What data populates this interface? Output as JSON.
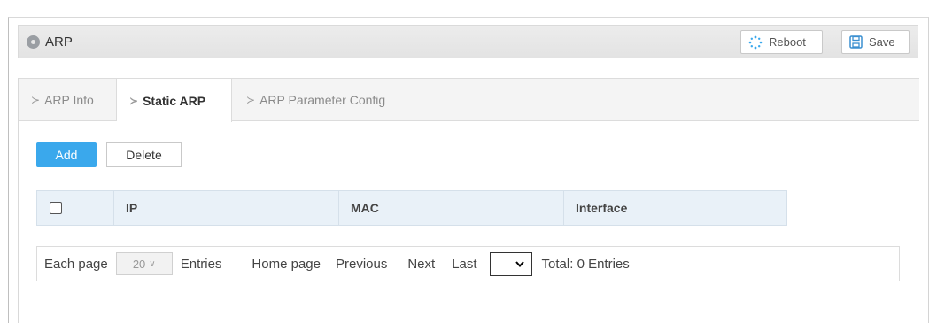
{
  "header": {
    "title": "ARP",
    "reboot_label": "Reboot",
    "save_label": "Save",
    "reboot_icon": "spinner-icon",
    "save_icon": "floppy-disk-icon",
    "title_icon": "circle-icon"
  },
  "tabs": [
    {
      "label": "ARP Info",
      "active": false
    },
    {
      "label": "Static ARP",
      "active": true
    },
    {
      "label": "ARP Parameter Config",
      "active": false
    }
  ],
  "actions": {
    "add_label": "Add",
    "delete_label": "Delete"
  },
  "table": {
    "columns": [
      "IP",
      "MAC",
      "Interface"
    ],
    "rows": []
  },
  "pager": {
    "each_page_label": "Each page",
    "page_size": "20",
    "entries_label": "Entries",
    "home_label": "Home page",
    "previous_label": "Previous",
    "next_label": "Next",
    "last_label": "Last",
    "total_label": "Total: 0 Entries"
  },
  "colors": {
    "accent": "#3aa8ec",
    "header_bg": "#e9f1f8"
  }
}
